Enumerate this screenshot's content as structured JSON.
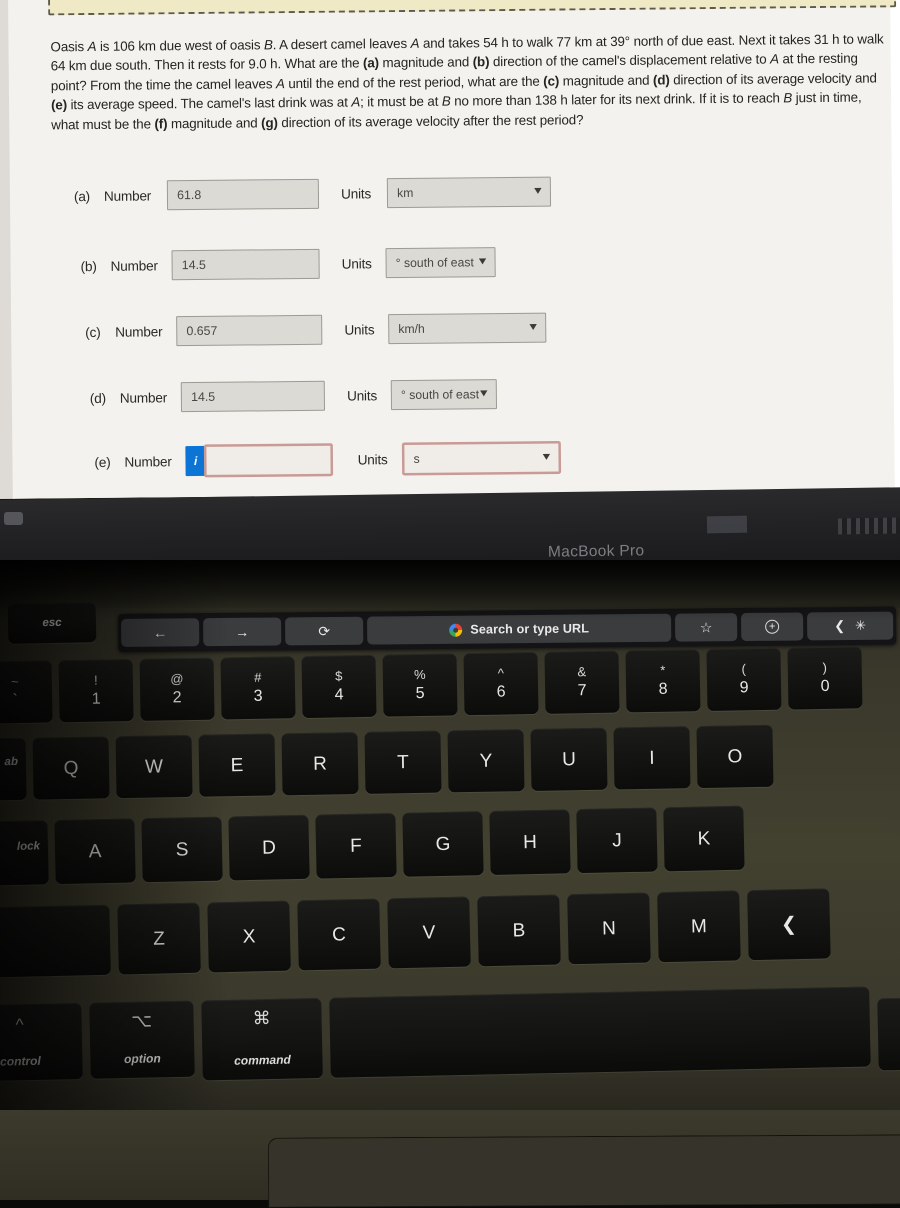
{
  "note": {
    "visible": true
  },
  "question": {
    "lines": [
      "Oasis A is 106 km due west of oasis B. A desert camel leaves A and takes 54 h to walk 77 km at 39° north of due east. Next it takes 31 h",
      "to walk 64 km due south. Then it rests for 9.0 h. What are the (a) magnitude and (b) direction of the camel's displacement relative to A",
      "at the resting point? From the time the camel leaves A until the end of the rest period, what are the (c) magnitude and (d) direction of",
      "its average velocity and (e) its average speed. The camel's last drink was at A; it must be at B no more than 138 h later for its next drink.",
      "If it is to reach B just in time, what must be the (f) magnitude and (g) direction of its average velocity after the rest period?"
    ],
    "full_text": "Oasis A is 106 km due west of oasis B. A desert camel leaves A and takes 54 h to walk 77 km at 39° north of due east. Next it takes 31 h to walk 64 km due south. Then it rests for 9.0 h. What are the (a) magnitude and (b) direction of the camel's displacement relative to A at the resting point? From the time the camel leaves A until the end of the rest period, what are the (c) magnitude and (d) direction of its average velocity and (e) its average speed. The camel's last drink was at A; it must be at B no more than 138 h later for its next drink. If it is to reach B just in time, what must be the (f) magnitude and (g) direction of its average velocity after the rest period?"
  },
  "number_label": "Number",
  "units_label": "Units",
  "answers": [
    {
      "tag": "(a)",
      "number": "61.8",
      "unit": "km",
      "highlighted": false,
      "info_badge": false
    },
    {
      "tag": "(b)",
      "number": "14.5",
      "unit": "° south of east",
      "highlighted": false,
      "info_badge": false
    },
    {
      "tag": "(c)",
      "number": "0.657",
      "unit": "km/h",
      "highlighted": false,
      "info_badge": false
    },
    {
      "tag": "(d)",
      "number": "14.5",
      "unit": "° south of east",
      "highlighted": false,
      "info_badge": false
    },
    {
      "tag": "(e)",
      "number": "",
      "unit": "s",
      "highlighted": true,
      "info_badge": true,
      "badge_text": "i"
    }
  ],
  "laptop": {
    "chin_logo": "MacBook Pro"
  },
  "touchbar": {
    "back_icon": "arrow-left-icon",
    "back_glyph": "←",
    "forward_icon": "arrow-right-icon",
    "forward_glyph": "→",
    "reload_icon": "reload-icon",
    "reload_glyph": "⟳",
    "url_placeholder": "Search or type URL",
    "google_icon": "google-logo-icon",
    "bookmark_icon": "star-icon",
    "bookmark_glyph": "☆",
    "new_tab_icon": "plus-circle-icon",
    "new_tab_glyph": "+",
    "collapse_icon": "chevron-left-icon",
    "collapse_glyph": "❮",
    "siri_icon": "brightness-icon",
    "siri_glyph": "✳"
  },
  "keyboard": {
    "esc": "esc",
    "row_numbers": [
      {
        "top": "~",
        "bot": "`"
      },
      {
        "top": "!",
        "bot": "1"
      },
      {
        "top": "@",
        "bot": "2"
      },
      {
        "top": "#",
        "bot": "3"
      },
      {
        "top": "$",
        "bot": "4"
      },
      {
        "top": "%",
        "bot": "5"
      },
      {
        "top": "^",
        "bot": "6"
      },
      {
        "top": "&",
        "bot": "7"
      },
      {
        "top": "*",
        "bot": "8"
      },
      {
        "top": "(",
        "bot": "9"
      },
      {
        "top": ")",
        "bot": "0"
      }
    ],
    "row_q": {
      "tab": "ab",
      "keys": [
        "Q",
        "W",
        "E",
        "R",
        "T",
        "Y",
        "U",
        "I",
        "O"
      ]
    },
    "row_a": {
      "lock": "lock",
      "keys": [
        "A",
        "S",
        "D",
        "F",
        "G",
        "H",
        "J",
        "K"
      ]
    },
    "row_z": {
      "keys": [
        "Z",
        "X",
        "C",
        "V",
        "B",
        "N",
        "M"
      ],
      "end_glyph": "❮"
    },
    "row_bottom": [
      {
        "top": "^",
        "label": "control"
      },
      {
        "top": "⌥",
        "label": "option"
      },
      {
        "top": "⌘",
        "label": "command"
      },
      {
        "top": "",
        "label": ""
      }
    ]
  },
  "colors": {
    "page_bg": "#f4f2ee",
    "note_bg": "#efe9c5",
    "field_bg": "#dcdad4",
    "field_border": "#9d9a93",
    "highlight_border": "#c99b96",
    "info_badge_bg": "#0b74d4",
    "touchbar_bg": "#141416",
    "keycap": "#131311",
    "base": "#42402f"
  }
}
